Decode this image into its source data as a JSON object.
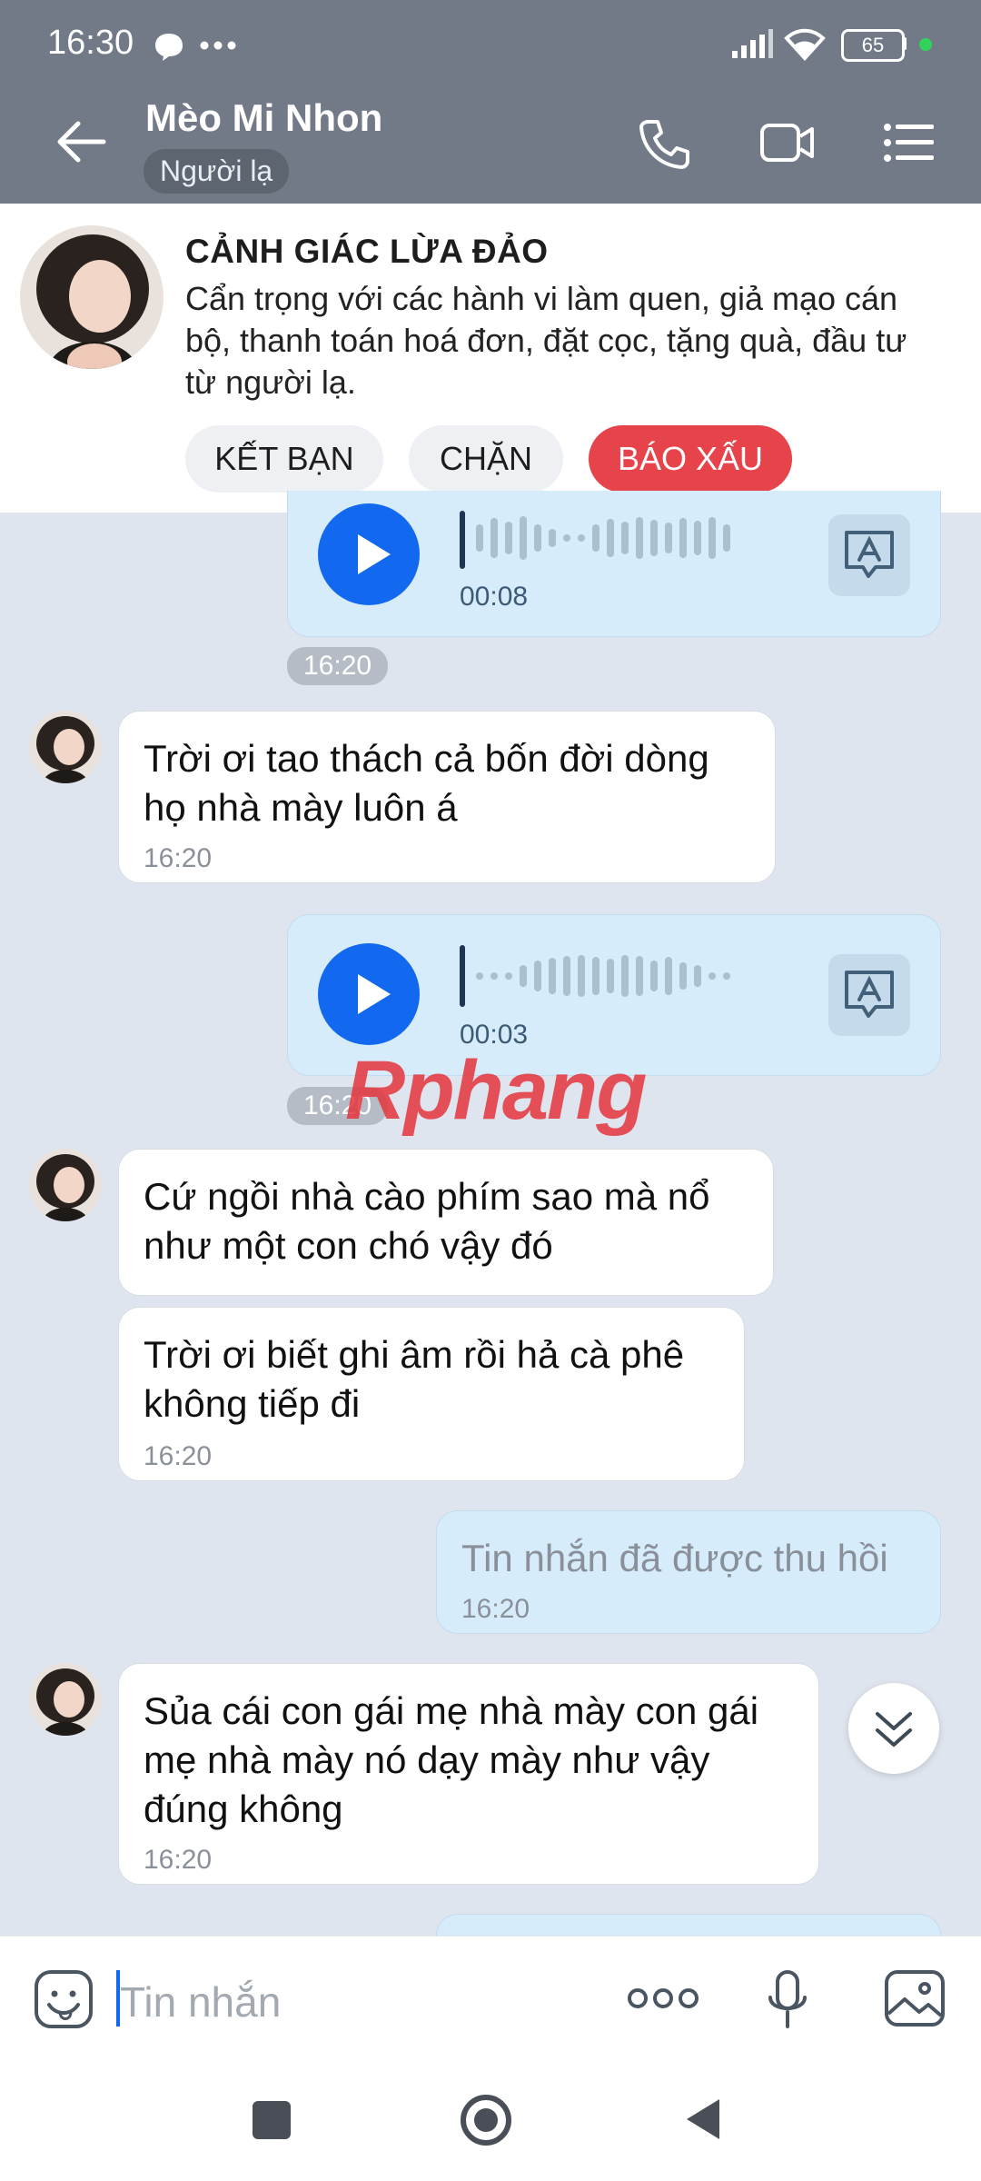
{
  "status": {
    "time": "16:30",
    "battery": "65"
  },
  "header": {
    "contact_name": "Mèo Mi Nhon",
    "badge": "Người lạ"
  },
  "warning": {
    "title": "CẢNH GIÁC LỪA ĐẢO",
    "text": "Cẩn trọng với các hành vi làm quen, giả mạo cán bộ, thanh toán hoá đơn, đặt cọc, tặng quà, đầu tư từ người lạ.",
    "actions": {
      "add_friend": "KẾT BẠN",
      "block": "CHẶN",
      "report": "BÁO XẤU"
    }
  },
  "chat": {
    "voice_1": {
      "duration": "00:08",
      "time": "16:20"
    },
    "msg_1": {
      "text_line1": "Trời ơi tao thách cả bốn đời dòng",
      "text_line2": "họ nhà mày luôn á",
      "time": "16:20"
    },
    "voice_2": {
      "duration": "00:03",
      "time": "16:20"
    },
    "watermark": "Rphang",
    "msg_2": {
      "text_line1": "Cứ ngồi nhà cào phím sao mà nổ",
      "text_line2": "như một con chó vậy đó"
    },
    "msg_3": {
      "text_line1": "Trời ơi biết ghi âm rồi hả cà phê",
      "text_line2": "không tiếp đi",
      "time": "16:20"
    },
    "recalled": {
      "text": "Tin nhắn đã được thu hồi",
      "time": "16:20"
    },
    "msg_4": {
      "text_line1": "Sủa cái con gái mẹ nhà mày con gái",
      "text_line2": "mẹ nhà mày nó dạy mày như vậy",
      "text_line3": "đúng không",
      "time": "16:20"
    }
  },
  "composer": {
    "placeholder": "Tin nhắn"
  },
  "colors": {
    "header": "#717a86",
    "accent": "#1268ef",
    "report": "#e7434a",
    "chat_bg": "#dfe5ee"
  }
}
